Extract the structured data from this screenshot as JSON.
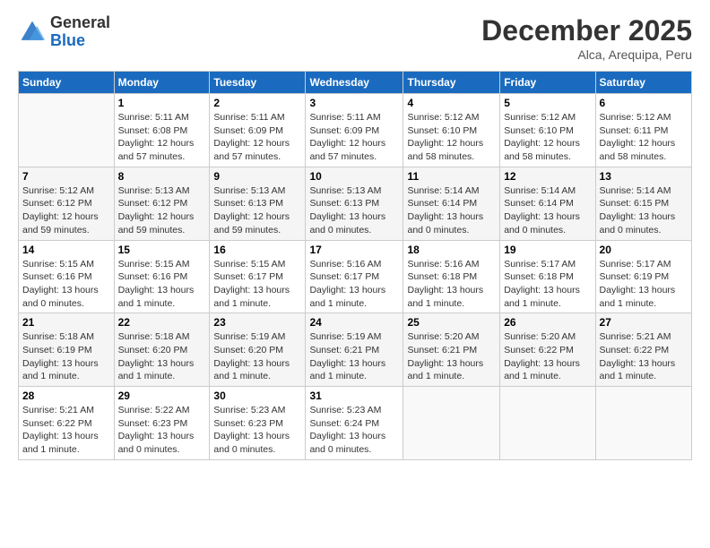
{
  "header": {
    "logo_general": "General",
    "logo_blue": "Blue",
    "month": "December 2025",
    "location": "Alca, Arequipa, Peru"
  },
  "weekdays": [
    "Sunday",
    "Monday",
    "Tuesday",
    "Wednesday",
    "Thursday",
    "Friday",
    "Saturday"
  ],
  "weeks": [
    [
      {
        "day": "",
        "info": ""
      },
      {
        "day": "1",
        "info": "Sunrise: 5:11 AM\nSunset: 6:08 PM\nDaylight: 12 hours\nand 57 minutes."
      },
      {
        "day": "2",
        "info": "Sunrise: 5:11 AM\nSunset: 6:09 PM\nDaylight: 12 hours\nand 57 minutes."
      },
      {
        "day": "3",
        "info": "Sunrise: 5:11 AM\nSunset: 6:09 PM\nDaylight: 12 hours\nand 57 minutes."
      },
      {
        "day": "4",
        "info": "Sunrise: 5:12 AM\nSunset: 6:10 PM\nDaylight: 12 hours\nand 58 minutes."
      },
      {
        "day": "5",
        "info": "Sunrise: 5:12 AM\nSunset: 6:10 PM\nDaylight: 12 hours\nand 58 minutes."
      },
      {
        "day": "6",
        "info": "Sunrise: 5:12 AM\nSunset: 6:11 PM\nDaylight: 12 hours\nand 58 minutes."
      }
    ],
    [
      {
        "day": "7",
        "info": "Sunrise: 5:12 AM\nSunset: 6:12 PM\nDaylight: 12 hours\nand 59 minutes."
      },
      {
        "day": "8",
        "info": "Sunrise: 5:13 AM\nSunset: 6:12 PM\nDaylight: 12 hours\nand 59 minutes."
      },
      {
        "day": "9",
        "info": "Sunrise: 5:13 AM\nSunset: 6:13 PM\nDaylight: 12 hours\nand 59 minutes."
      },
      {
        "day": "10",
        "info": "Sunrise: 5:13 AM\nSunset: 6:13 PM\nDaylight: 13 hours\nand 0 minutes."
      },
      {
        "day": "11",
        "info": "Sunrise: 5:14 AM\nSunset: 6:14 PM\nDaylight: 13 hours\nand 0 minutes."
      },
      {
        "day": "12",
        "info": "Sunrise: 5:14 AM\nSunset: 6:14 PM\nDaylight: 13 hours\nand 0 minutes."
      },
      {
        "day": "13",
        "info": "Sunrise: 5:14 AM\nSunset: 6:15 PM\nDaylight: 13 hours\nand 0 minutes."
      }
    ],
    [
      {
        "day": "14",
        "info": "Sunrise: 5:15 AM\nSunset: 6:16 PM\nDaylight: 13 hours\nand 0 minutes."
      },
      {
        "day": "15",
        "info": "Sunrise: 5:15 AM\nSunset: 6:16 PM\nDaylight: 13 hours\nand 1 minute."
      },
      {
        "day": "16",
        "info": "Sunrise: 5:15 AM\nSunset: 6:17 PM\nDaylight: 13 hours\nand 1 minute."
      },
      {
        "day": "17",
        "info": "Sunrise: 5:16 AM\nSunset: 6:17 PM\nDaylight: 13 hours\nand 1 minute."
      },
      {
        "day": "18",
        "info": "Sunrise: 5:16 AM\nSunset: 6:18 PM\nDaylight: 13 hours\nand 1 minute."
      },
      {
        "day": "19",
        "info": "Sunrise: 5:17 AM\nSunset: 6:18 PM\nDaylight: 13 hours\nand 1 minute."
      },
      {
        "day": "20",
        "info": "Sunrise: 5:17 AM\nSunset: 6:19 PM\nDaylight: 13 hours\nand 1 minute."
      }
    ],
    [
      {
        "day": "21",
        "info": "Sunrise: 5:18 AM\nSunset: 6:19 PM\nDaylight: 13 hours\nand 1 minute."
      },
      {
        "day": "22",
        "info": "Sunrise: 5:18 AM\nSunset: 6:20 PM\nDaylight: 13 hours\nand 1 minute."
      },
      {
        "day": "23",
        "info": "Sunrise: 5:19 AM\nSunset: 6:20 PM\nDaylight: 13 hours\nand 1 minute."
      },
      {
        "day": "24",
        "info": "Sunrise: 5:19 AM\nSunset: 6:21 PM\nDaylight: 13 hours\nand 1 minute."
      },
      {
        "day": "25",
        "info": "Sunrise: 5:20 AM\nSunset: 6:21 PM\nDaylight: 13 hours\nand 1 minute."
      },
      {
        "day": "26",
        "info": "Sunrise: 5:20 AM\nSunset: 6:22 PM\nDaylight: 13 hours\nand 1 minute."
      },
      {
        "day": "27",
        "info": "Sunrise: 5:21 AM\nSunset: 6:22 PM\nDaylight: 13 hours\nand 1 minute."
      }
    ],
    [
      {
        "day": "28",
        "info": "Sunrise: 5:21 AM\nSunset: 6:22 PM\nDaylight: 13 hours\nand 1 minute."
      },
      {
        "day": "29",
        "info": "Sunrise: 5:22 AM\nSunset: 6:23 PM\nDaylight: 13 hours\nand 0 minutes."
      },
      {
        "day": "30",
        "info": "Sunrise: 5:23 AM\nSunset: 6:23 PM\nDaylight: 13 hours\nand 0 minutes."
      },
      {
        "day": "31",
        "info": "Sunrise: 5:23 AM\nSunset: 6:24 PM\nDaylight: 13 hours\nand 0 minutes."
      },
      {
        "day": "",
        "info": ""
      },
      {
        "day": "",
        "info": ""
      },
      {
        "day": "",
        "info": ""
      }
    ]
  ]
}
